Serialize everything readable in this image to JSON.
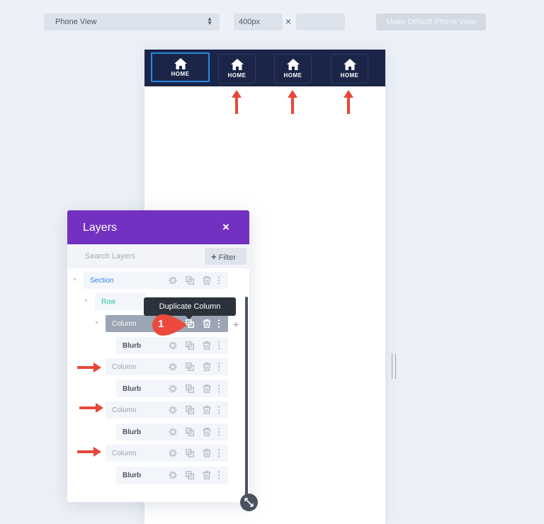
{
  "toolbar": {
    "view_select": "Phone View",
    "width_value": "400px",
    "times_symbol": "×",
    "height_value": "",
    "default_button": "Make Default Phone View"
  },
  "canvas": {
    "nav_items": [
      {
        "label": "HOME",
        "selected": true
      },
      {
        "label": "HOME",
        "selected": false
      },
      {
        "label": "HOME",
        "selected": false
      },
      {
        "label": "HOME",
        "selected": false
      }
    ],
    "nav_bg": "#1b2548",
    "selected_outline": "#2b87e3"
  },
  "layers": {
    "title": "Layers",
    "close": "×",
    "search_placeholder": "Search Layers",
    "filter_label": "Filter",
    "filter_plus": "+",
    "header_color": "#7231c0",
    "tree": [
      {
        "label": "Section",
        "level": 0,
        "color": "#2b87e3"
      },
      {
        "label": "Row",
        "level": 1,
        "color": "#29c4a9"
      },
      {
        "label": "Column",
        "level": 2,
        "active": true
      },
      {
        "label": "Blurb",
        "level": 3
      },
      {
        "label": "Column",
        "level": 2
      },
      {
        "label": "Blurb",
        "level": 3
      },
      {
        "label": "Column",
        "level": 2
      },
      {
        "label": "Blurb",
        "level": 3
      },
      {
        "label": "Column",
        "level": 2
      },
      {
        "label": "Blurb",
        "level": 3
      }
    ],
    "add_plus": "+",
    "tooltip": "Duplicate Column",
    "badge_number": "1",
    "badge_color": "#ec4a3d",
    "arrow_color": "#e5483a"
  }
}
